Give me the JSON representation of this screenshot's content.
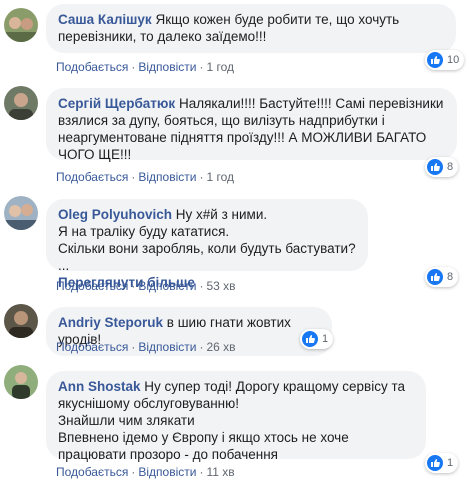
{
  "comments": [
    {
      "author": "Саша Калішук",
      "text": "Якщо кожен буде робити те, що хочуть перевізники, то далеко заїдемо!!!",
      "like_label": "Подобається",
      "reply_label": "Відповісти",
      "time": "1 год",
      "reactions": "10"
    },
    {
      "author": "Сергій Щербатюк",
      "text": "Налякали!!!! Бастуйте!!!! Самі перевізники взялися за дупу, бояться, що вилізуть надприбутки і неаргументоване підняття проїзду!!! А МОЖЛИВИ БАГАТО ЧОГО ЩЕ!!!",
      "like_label": "Подобається",
      "reply_label": "Відповісти",
      "time": "1 год",
      "reactions": "8"
    },
    {
      "author": "Oleg Polyuhovich",
      "text": "Ну х#й з ними.\nЯ на тралiку буду кататися.\nСкільки вони заробляь, коли будуть бастувати? ...",
      "see_more": "Переглянути більше",
      "like_label": "Подобається",
      "reply_label": "Відповісти",
      "time": "53 хв",
      "reactions": "8"
    },
    {
      "author": "Andriy Steporuk",
      "text": "в шию гнати жовтих уродів!",
      "like_label": "Подобається",
      "reply_label": "Відповісти",
      "time": "26 хв",
      "reactions": "1"
    },
    {
      "author": "Ann Shostak",
      "text": "Ну супер тоді! Дорогу кращому сервісу та якуснішому обслуговуванню!\nЗнайшли чим злякати\nВпевнено ідемо у Європу і якщо хтось не хоче працювати прозоро - до побачення",
      "like_label": "Подобається",
      "reply_label": "Відповісти",
      "time": "11 хв",
      "reactions": "1"
    }
  ],
  "separator": "·",
  "colors": {
    "author": "#385898",
    "bubble": "#f2f3f5",
    "like": "#1877f2",
    "meta": "#606770"
  }
}
